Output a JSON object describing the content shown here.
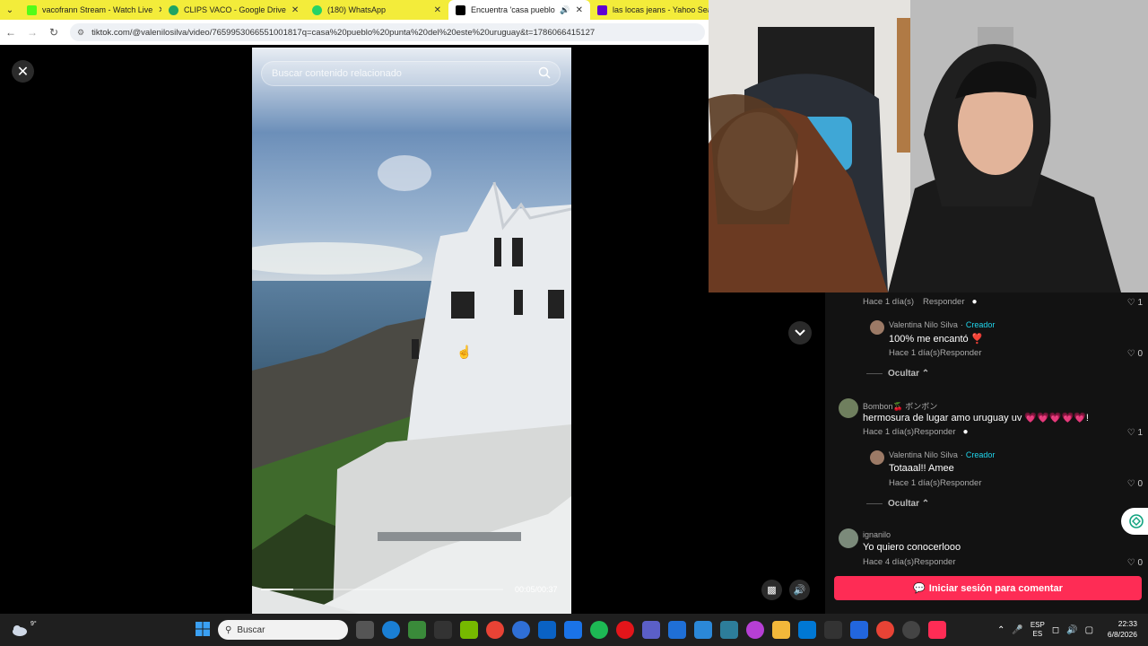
{
  "browser": {
    "tabs": [
      {
        "title": "vacofrann Stream - Watch Live",
        "color": "#53fc18",
        "active": false
      },
      {
        "title": "CLIPS VACO - Google Drive",
        "color": "#1fa463",
        "active": false
      },
      {
        "title": "(180) WhatsApp",
        "color": "#25d366",
        "active": false
      },
      {
        "title": "Encuentra 'casa pueblo pun",
        "color": "#000000",
        "active": true
      },
      {
        "title": "las locas jeans - Yahoo Search",
        "color": "#6001d2",
        "active": false
      }
    ],
    "url": "tiktok.com/@valenilosilva/video/7659953066551001817q=casa%20pueblo%20punta%20del%20este%20uruguay&t=1786066415127"
  },
  "video": {
    "search_placeholder": "Buscar contenido relacionado",
    "timecode": "00:05/00:37",
    "progress": 0.135
  },
  "comments": [
    {
      "kind": "meta",
      "time": "Hace 1 día(s)",
      "reply": "Responder",
      "likes": "1"
    },
    {
      "kind": "reply",
      "name": "Valentina Nilo Silva",
      "badge": "Creador",
      "text": "100% me encantó ❣️",
      "time": "Hace 1 día(s)",
      "reply": "Responder",
      "likes": "0"
    },
    {
      "kind": "hide",
      "label": "Ocultar"
    },
    {
      "kind": "top",
      "name": "Bombon🍒 ボンボン",
      "text": "hermosura de lugar amo uruguay uv 💗💗💗💗💗!",
      "time": "Hace 1 día(s)",
      "reply": "Responder",
      "likes": "1"
    },
    {
      "kind": "reply",
      "name": "Valentina Nilo Silva",
      "badge": "Creador",
      "text": "Totaaal!! Amee",
      "time": "Hace 1 día(s)",
      "reply": "Responder",
      "likes": "0"
    },
    {
      "kind": "hide",
      "label": "Ocultar"
    },
    {
      "kind": "top",
      "name": "ignanilo",
      "text": "Yo quiero conocerlooo",
      "time": "Hace 4 día(s)",
      "reply": "Responder",
      "likes": "0"
    }
  ],
  "login_button": "Iniciar sesión para comentar",
  "taskbar": {
    "weather_temp": "9°",
    "search_placeholder": "Buscar",
    "lang_top": "ESP",
    "lang_bottom": "ES",
    "time": "22:33",
    "date": "6/8/2026"
  },
  "colors": {
    "tiktok_red": "#fe2c55",
    "creator_blue": "#20d5ec",
    "tab_bar": "#f3ec3a"
  }
}
